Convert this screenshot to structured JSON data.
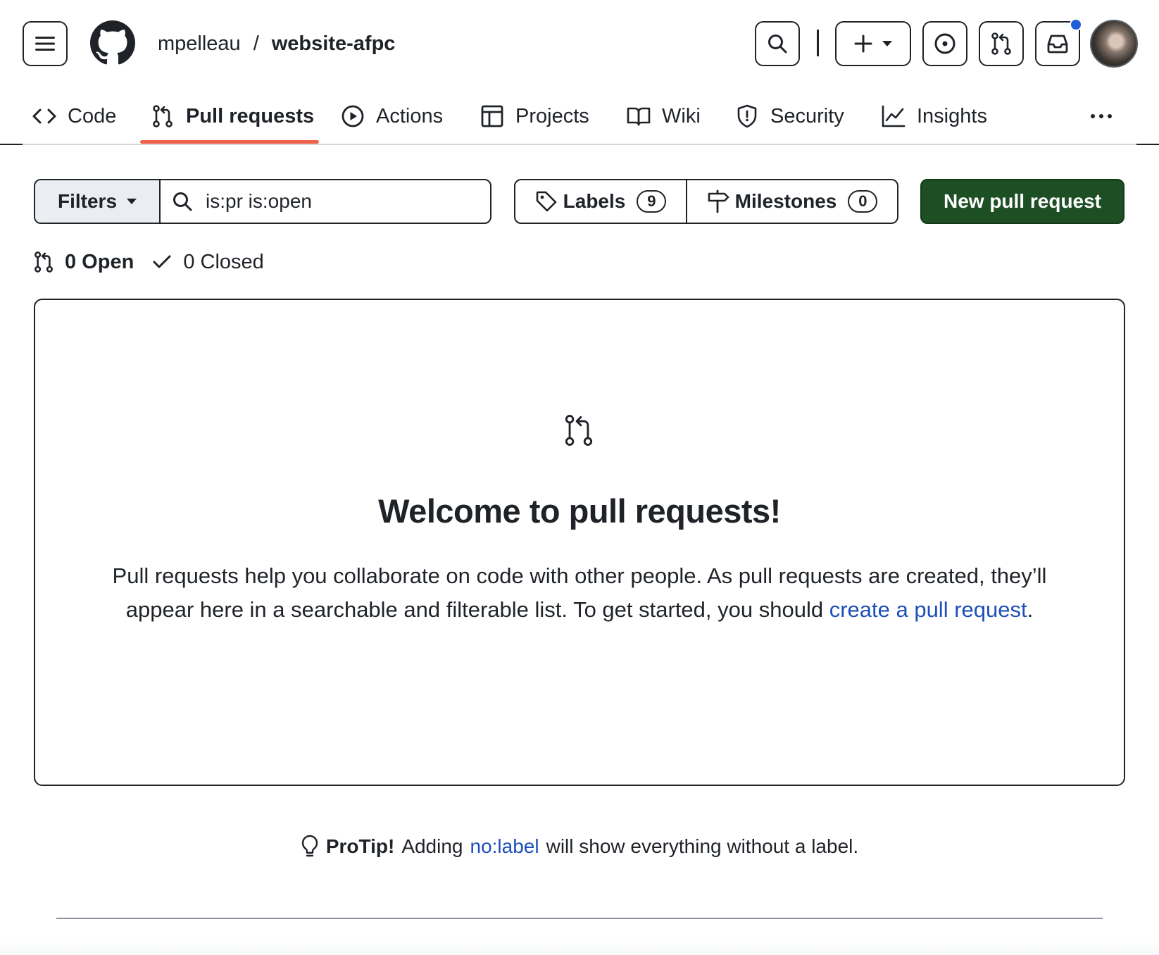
{
  "header": {
    "owner": "mpelleau",
    "separator": "/",
    "repo": "website-afpc",
    "icons": [
      "hamburger-icon",
      "github-logo-icon",
      "search-icon",
      "plus-icon",
      "issue-icon",
      "pull-request-icon",
      "inbox-icon"
    ],
    "has_unread_notifications": true
  },
  "tabs": [
    {
      "label": "Code",
      "icon": "code-icon"
    },
    {
      "label": "Pull requests",
      "icon": "pull-request-icon",
      "active": true
    },
    {
      "label": "Actions",
      "icon": "play-icon"
    },
    {
      "label": "Projects",
      "icon": "table-icon"
    },
    {
      "label": "Wiki",
      "icon": "book-icon"
    },
    {
      "label": "Security",
      "icon": "shield-icon"
    },
    {
      "label": "Insights",
      "icon": "graph-icon"
    }
  ],
  "filter_bar": {
    "filters_label": "Filters",
    "search_value": "is:pr is:open",
    "labels_label": "Labels",
    "labels_count": "9",
    "milestones_label": "Milestones",
    "milestones_count": "0",
    "new_pr_label": "New pull request"
  },
  "states": {
    "open_label": "0 Open",
    "closed_label": "0 Closed"
  },
  "blankslate": {
    "title": "Welcome to pull requests!",
    "body_prefix": "Pull requests help you collaborate on code with other people. As pull requests are created, they’ll appear here in a searchable and filterable list. To get started, you should ",
    "link_text": "create a pull request",
    "body_suffix": "."
  },
  "protip": {
    "label": "ProTip!",
    "text_before": "Adding",
    "link_text": "no:label",
    "text_after": "will show everything without a label."
  },
  "colors": {
    "accent_link": "#1d4fb8",
    "primary_button": "#1e4f24",
    "active_tab_underline": "#f0634a",
    "notification_dot": "#1f5ed8"
  }
}
